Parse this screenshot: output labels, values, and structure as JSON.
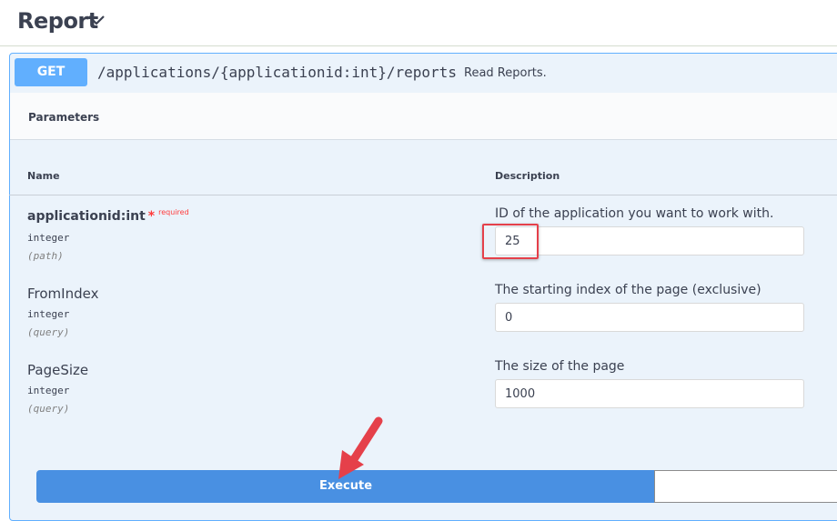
{
  "tag": {
    "title": "Report"
  },
  "operation": {
    "method": "GET",
    "path": "/applications/{applicationid:int}/reports",
    "summary": "Read Reports."
  },
  "parameters": {
    "section_title": "Parameters",
    "col_name": "Name",
    "col_description": "Description",
    "items": [
      {
        "name": "applicationid:int",
        "required_mark": "*",
        "required_label": "required",
        "type": "integer",
        "in": "(path)",
        "description": "ID of the application you want to work with.",
        "value": "25"
      },
      {
        "name": "FromIndex",
        "type": "integer",
        "in": "(query)",
        "description": "The starting index of the page (exclusive)",
        "value": "0"
      },
      {
        "name": "PageSize",
        "type": "integer",
        "in": "(query)",
        "description": "The size of the page",
        "value": "1000"
      }
    ]
  },
  "actions": {
    "execute_label": "Execute",
    "clear_label": ""
  },
  "colors": {
    "get": "#61affe",
    "execute": "#4990e2",
    "annotation": "#e5404a"
  }
}
